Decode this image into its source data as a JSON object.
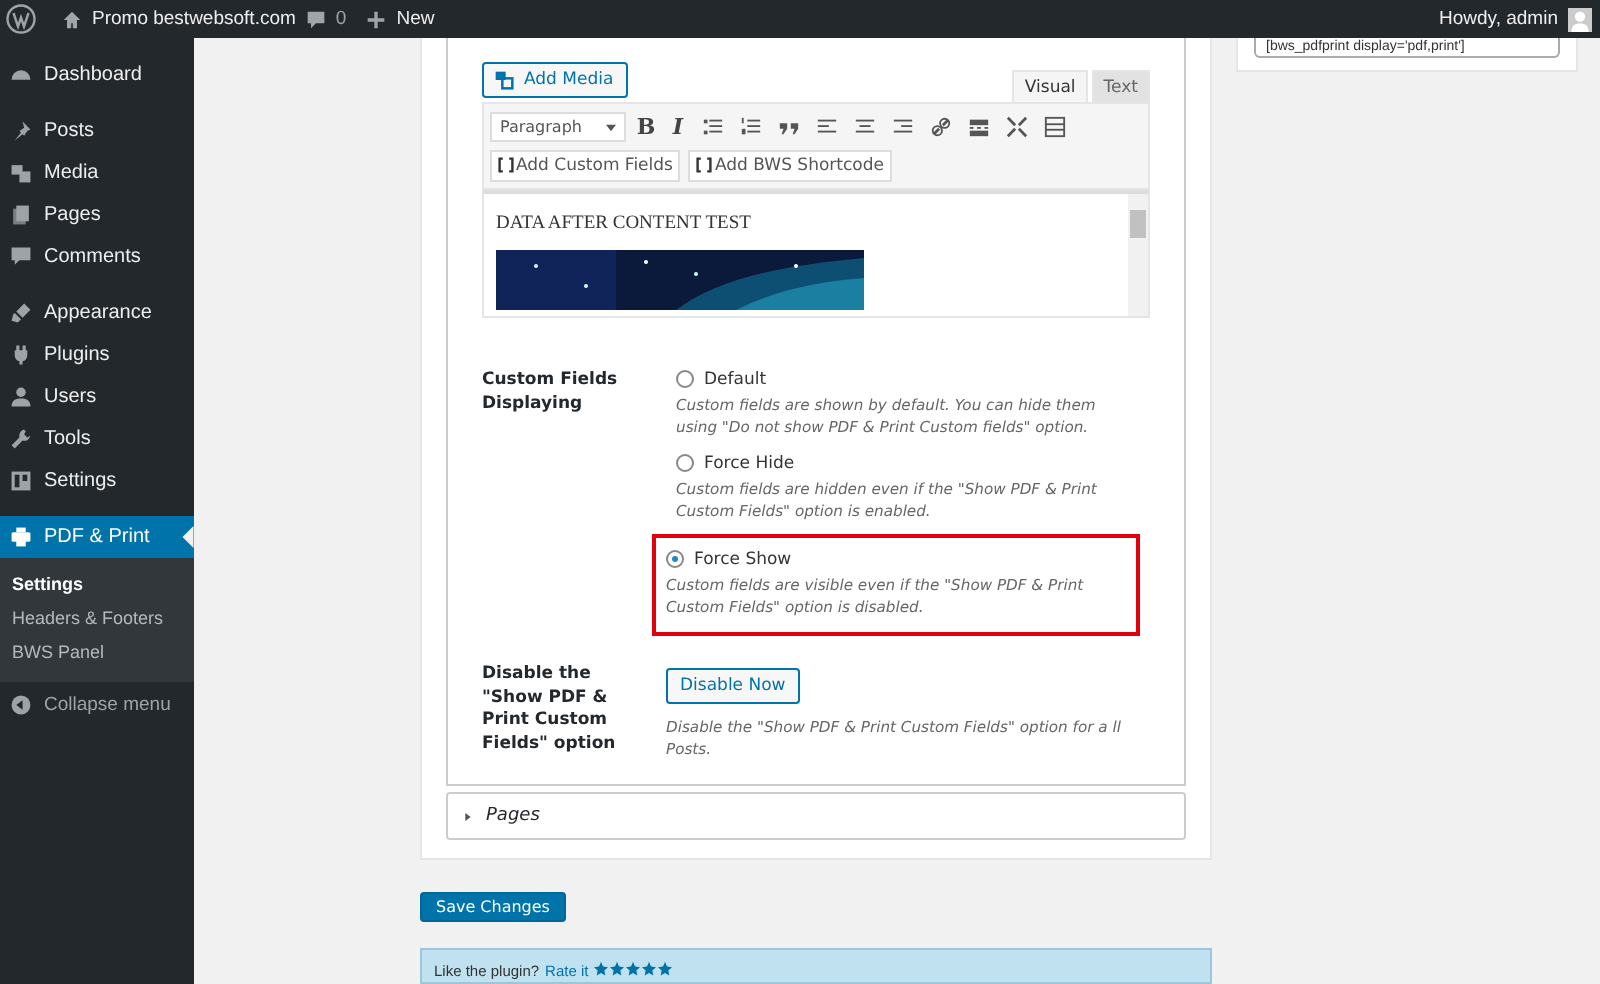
{
  "admin_bar": {
    "site_name": "Promo bestwebsoft.com",
    "comments_count": "0",
    "new_label": "New",
    "greeting": "Howdy, admin"
  },
  "sidebar": {
    "groups": [
      [
        {
          "label": "Dashboard",
          "selected": false
        }
      ],
      [
        {
          "label": "Posts",
          "selected": false
        },
        {
          "label": "Media",
          "selected": false
        },
        {
          "label": "Pages",
          "selected": false
        },
        {
          "label": "Comments",
          "selected": false
        }
      ],
      [
        {
          "label": "Appearance",
          "selected": false
        },
        {
          "label": "Plugins",
          "selected": false
        },
        {
          "label": "Users",
          "selected": false
        },
        {
          "label": "Tools",
          "selected": false
        },
        {
          "label": "Settings",
          "selected": false
        }
      ],
      [
        {
          "label": "PDF & Print",
          "selected": true,
          "submenu": [
            {
              "label": "Settings",
              "selected": true
            },
            {
              "label": "Headers & Footers",
              "selected": false
            },
            {
              "label": "BWS Panel",
              "selected": false
            }
          ]
        }
      ]
    ],
    "collapse_label": "Collapse menu"
  },
  "shortcode_widget": {
    "value": "[bws_pdfprint display='pdf,print']"
  },
  "editor": {
    "add_media_label": "Add Media",
    "tabs": [
      {
        "label": "Visual",
        "selected": true
      },
      {
        "label": "Text",
        "selected": false
      }
    ],
    "format_select": "Paragraph",
    "bold_label": "B",
    "italic_label": "I",
    "shortcode_buttons": [
      "Add Custom Fields",
      "Add BWS Shortcode"
    ],
    "content_heading": "DATA AFTER CONTENT TEST"
  },
  "custom_fields": {
    "label": "Custom Fields Displaying",
    "options": [
      {
        "label": "Default",
        "description": "Custom fields are shown by default. You can hide them using \"Do not show PDF & Print Custom fields\" option.",
        "selected": false,
        "highlighted": false
      },
      {
        "label": "Force Hide",
        "description": "Custom fields are hidden even if the \"Show PDF & Print Custom Fields\" option is enabled.",
        "selected": false,
        "highlighted": false
      },
      {
        "label": "Force Show",
        "description": "Custom fields are visible even if the \"Show PDF & Print Custom Fields\" option is disabled.",
        "selected": true,
        "highlighted": true
      }
    ]
  },
  "disable_row": {
    "label": "Disable the \"Show PDF & Print Custom Fields\" option",
    "button": "Disable Now",
    "description": "Disable the \"Show PDF & Print Custom Fields\" option for a ll Posts."
  },
  "pages_section": {
    "label": "Pages",
    "expanded": false
  },
  "save_button": "Save Changes",
  "notice": {
    "text": "Like the plugin?",
    "link": "Rate it",
    "stars": 5
  }
}
